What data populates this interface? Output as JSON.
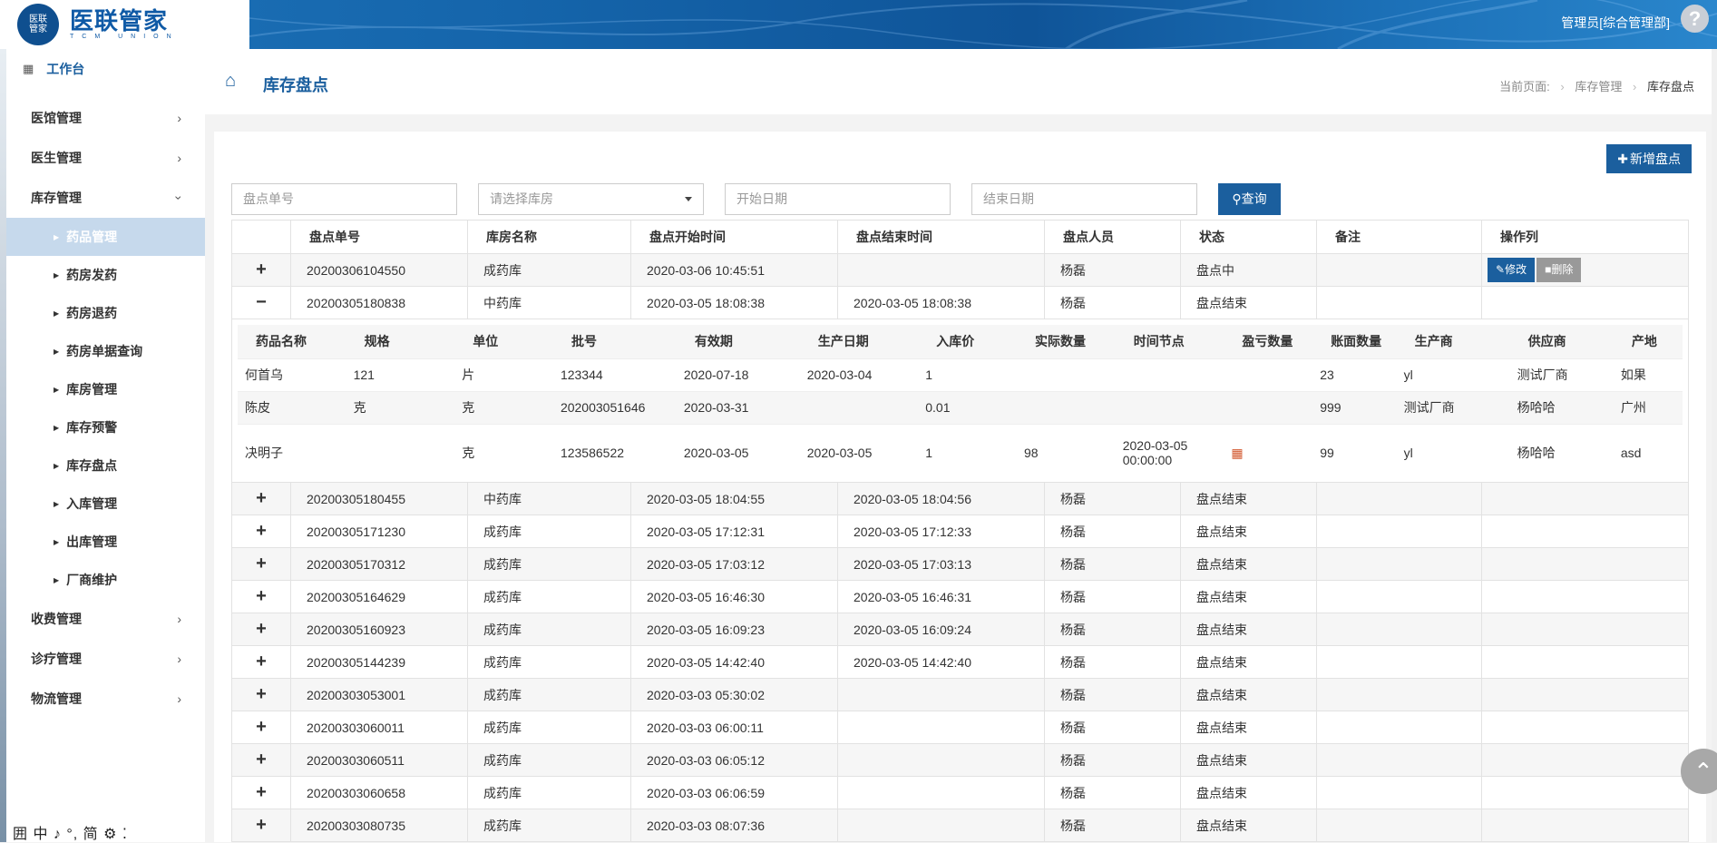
{
  "header": {
    "logo_badge": "医联\n管家",
    "logo_cn": "医联管家",
    "logo_en": "TCM UNION",
    "user": "管理员[综合管理部]",
    "help_glyph": "?"
  },
  "sidebar": {
    "workbench": "工作台",
    "items": [
      {
        "label": "医馆管理"
      },
      {
        "label": "医生管理"
      },
      {
        "label": "库存管理"
      }
    ],
    "subitems": [
      {
        "label": "药品管理"
      },
      {
        "label": "药房发药"
      },
      {
        "label": "药房退药"
      },
      {
        "label": "药房单据查询"
      },
      {
        "label": "库房管理"
      },
      {
        "label": "库存预警"
      },
      {
        "label": "库存盘点"
      },
      {
        "label": "入库管理"
      },
      {
        "label": "出库管理"
      },
      {
        "label": "厂商维护"
      }
    ],
    "items_after": [
      {
        "label": "收费管理"
      },
      {
        "label": "诊疗管理"
      },
      {
        "label": "物流管理"
      }
    ],
    "ime": "囲 中 ♪ °, 简 ⚙ ⁚"
  },
  "page": {
    "title": "库存盘点",
    "crumb_label": "当前页面:",
    "crumb_1": "库存管理",
    "crumb_2": "库存盘点"
  },
  "toolbar": {
    "add_label": "新增盘点",
    "order_placeholder": "盘点单号",
    "warehouse_placeholder": "请选择库房",
    "start_placeholder": "开始日期",
    "end_placeholder": "结束日期",
    "search_label": "查询"
  },
  "grid": {
    "headers": [
      "盘点单号",
      "库房名称",
      "盘点开始时间",
      "盘点结束时间",
      "盘点人员",
      "状态",
      "备注",
      "操作列"
    ],
    "edit_label": "修改",
    "delete_label": "删除",
    "rows": [
      {
        "toggle": "+",
        "no": "20200306104550",
        "wh": "成药库",
        "start": "2020-03-06 10:45:51",
        "end": "",
        "person": "杨磊",
        "status": "盘点中",
        "note": ""
      },
      {
        "toggle": "−",
        "no": "20200305180838",
        "wh": "中药库",
        "start": "2020-03-05 18:08:38",
        "end": "2020-03-05 18:08:38",
        "person": "杨磊",
        "status": "盘点结束",
        "note": ""
      },
      {
        "toggle": "+",
        "no": "20200305180455",
        "wh": "中药库",
        "start": "2020-03-05 18:04:55",
        "end": "2020-03-05 18:04:56",
        "person": "杨磊",
        "status": "盘点结束",
        "note": ""
      },
      {
        "toggle": "+",
        "no": "20200305171230",
        "wh": "成药库",
        "start": "2020-03-05 17:12:31",
        "end": "2020-03-05 17:12:33",
        "person": "杨磊",
        "status": "盘点结束",
        "note": ""
      },
      {
        "toggle": "+",
        "no": "20200305170312",
        "wh": "成药库",
        "start": "2020-03-05 17:03:12",
        "end": "2020-03-05 17:03:13",
        "person": "杨磊",
        "status": "盘点结束",
        "note": ""
      },
      {
        "toggle": "+",
        "no": "20200305164629",
        "wh": "成药库",
        "start": "2020-03-05 16:46:30",
        "end": "2020-03-05 16:46:31",
        "person": "杨磊",
        "status": "盘点结束",
        "note": ""
      },
      {
        "toggle": "+",
        "no": "20200305160923",
        "wh": "成药库",
        "start": "2020-03-05 16:09:23",
        "end": "2020-03-05 16:09:24",
        "person": "杨磊",
        "status": "盘点结束",
        "note": ""
      },
      {
        "toggle": "+",
        "no": "20200305144239",
        "wh": "成药库",
        "start": "2020-03-05 14:42:40",
        "end": "2020-03-05 14:42:40",
        "person": "杨磊",
        "status": "盘点结束",
        "note": ""
      },
      {
        "toggle": "+",
        "no": "20200303053001",
        "wh": "成药库",
        "start": "2020-03-03 05:30:02",
        "end": "",
        "person": "杨磊",
        "status": "盘点结束",
        "note": ""
      },
      {
        "toggle": "+",
        "no": "20200303060011",
        "wh": "成药库",
        "start": "2020-03-03 06:00:11",
        "end": "",
        "person": "杨磊",
        "status": "盘点结束",
        "note": ""
      },
      {
        "toggle": "+",
        "no": "20200303060511",
        "wh": "成药库",
        "start": "2020-03-03 06:05:12",
        "end": "",
        "person": "杨磊",
        "status": "盘点结束",
        "note": ""
      },
      {
        "toggle": "+",
        "no": "20200303060658",
        "wh": "成药库",
        "start": "2020-03-03 06:06:59",
        "end": "",
        "person": "杨磊",
        "status": "盘点结束",
        "note": ""
      },
      {
        "toggle": "+",
        "no": "20200303080735",
        "wh": "成药库",
        "start": "2020-03-03 08:07:36",
        "end": "",
        "person": "杨磊",
        "status": "盘点结束",
        "note": ""
      }
    ]
  },
  "detail": {
    "headers": [
      "药品名称",
      "规格",
      "单位",
      "批号",
      "有效期",
      "生产日期",
      "入库价",
      "实际数量",
      "时间节点",
      "盈亏数量",
      "账面数量",
      "生产商",
      "供应商",
      "产地"
    ],
    "rows": [
      [
        "何首乌",
        "121",
        "片",
        "123344",
        "2020-07-18",
        "2020-03-04",
        "1",
        "",
        "",
        "",
        "23",
        "yl",
        "测试厂商",
        "如果"
      ],
      [
        "陈皮",
        "克",
        "克",
        "202003051646",
        "2020-03-31",
        "",
        "0.01",
        "",
        "",
        "",
        "999",
        "测试厂商",
        "杨哈哈",
        "广州"
      ],
      [
        "决明子",
        "",
        "克",
        "123586522",
        "2020-03-05",
        "2020-03-05",
        "1",
        "98",
        "2020-03-05\n00:00:00",
        "",
        "99",
        "yl",
        "杨哈哈",
        "asd"
      ]
    ],
    "profit_icon": "home-alert-icon"
  },
  "colors": {
    "brand": "#1b5f9e",
    "active_sub": "#c6d9ec"
  }
}
